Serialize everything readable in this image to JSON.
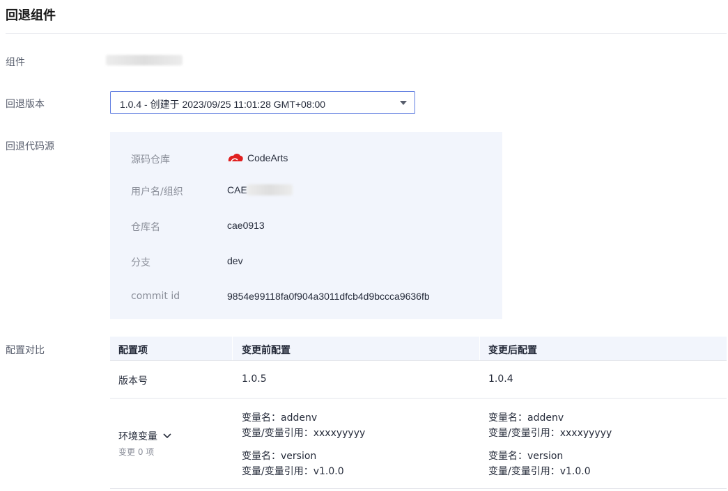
{
  "page": {
    "title": "回退组件"
  },
  "fields": {
    "component_label": "组件",
    "version_label": "回退版本",
    "source_label": "回退代码源",
    "compare_label": "配置对比"
  },
  "version_select": {
    "value": "1.0.4 - 创建于 2023/09/25 11:01:28 GMT+08:00"
  },
  "repo": {
    "source_label": "源码仓库",
    "source_value": "CodeArts",
    "user_label": "用户名/组织",
    "user_value": "CAE",
    "name_label": "仓库名",
    "name_value": "cae0913",
    "branch_label": "分支",
    "branch_value": "dev",
    "commit_label": "commit id",
    "commit_value": "9854e99118fa0f904a3011dfcb4d9bccca9636fb"
  },
  "compare": {
    "headers": [
      "配置项",
      "变更前配置",
      "变更后配置"
    ],
    "version_row": {
      "item": "版本号",
      "before": "1.0.5",
      "after": "1.0.4"
    },
    "env_row": {
      "item": "环境变量",
      "sub": "变更 0 项",
      "before": [
        {
          "name": "变量名：addenv",
          "ref": "变量/变量引用：xxxxyyyyy"
        },
        {
          "name": "变量名：version",
          "ref": "变量/变量引用：v1.0.0"
        }
      ],
      "after": [
        {
          "name": "变量名：addenv",
          "ref": "变量/变量引用：xxxxyyyyy"
        },
        {
          "name": "变量名：version",
          "ref": "变量/变量引用：v1.0.0"
        }
      ]
    }
  },
  "colors": {
    "accent": "#5e7ce0",
    "panel_bg": "#f2f5fc",
    "brand_red": "#e02020"
  }
}
